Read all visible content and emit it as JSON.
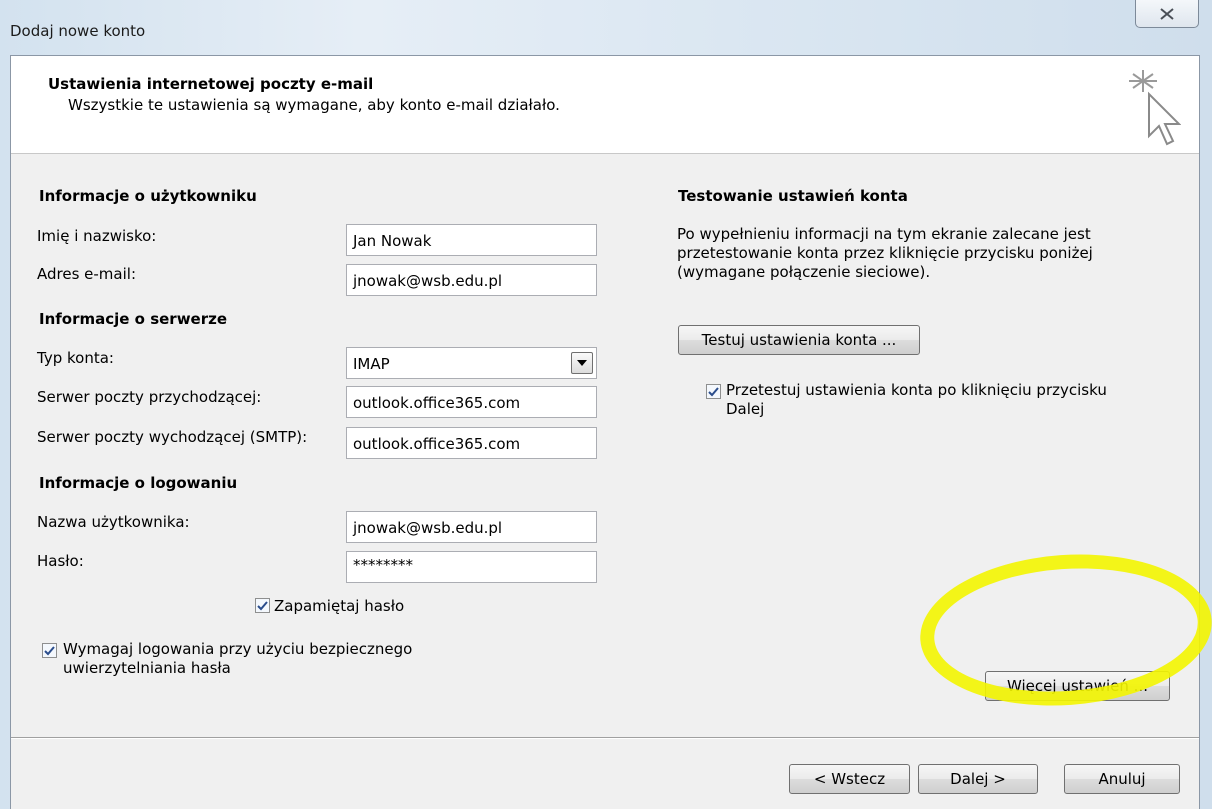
{
  "window": {
    "title": "Dodaj nowe konto"
  },
  "header": {
    "title": "Ustawienia internetowej poczty e-mail",
    "subtitle": "Wszystkie te ustawienia są wymagane, aby konto e-mail działało.",
    "icon": "cursor-sparkle-icon"
  },
  "user_info": {
    "heading": "Informacje o użytkowniku",
    "name_label": "Imię i nazwisko:",
    "name_value": "Jan Nowak",
    "email_label": "Adres e-mail:",
    "email_value": "jnowak@wsb.edu.pl"
  },
  "server_info": {
    "heading": "Informacje o serwerze",
    "account_type_label": "Typ konta:",
    "account_type_value": "IMAP",
    "incoming_label": "Serwer poczty przychodzącej:",
    "incoming_value": "outlook.office365.com",
    "outgoing_label": "Serwer poczty wychodzącej (SMTP):",
    "outgoing_value": "outlook.office365.com"
  },
  "login_info": {
    "heading": "Informacje o logowaniu",
    "username_label": "Nazwa użytkownika:",
    "username_value": "jnowak@wsb.edu.pl",
    "password_label": "Hasło:",
    "password_value": "********",
    "remember_label": "Zapamiętaj hasło",
    "remember_checked": true,
    "spa_label": "Wymagaj logowania przy użyciu bezpiecznego uwierzytelniania hasła",
    "spa_checked": true
  },
  "test": {
    "heading": "Testowanie ustawień konta",
    "description": "Po wypełnieniu informacji na tym ekranie zalecane jest przetestowanie konta przez kliknięcie przycisku poniżej (wymagane połączenie sieciowe).",
    "test_button": "Testuj ustawienia konta ...",
    "auto_test_label": "Przetestuj ustawienia konta po kliknięciu przycisku Dalej",
    "auto_test_checked": true
  },
  "more_settings_button": "Więcej ustawień ...",
  "footer": {
    "back": "< Wstecz",
    "next": "Dalej >",
    "cancel": "Anuluj"
  },
  "colors": {
    "highlight": "#f3f500",
    "checkmark": "#2b4d8c"
  }
}
